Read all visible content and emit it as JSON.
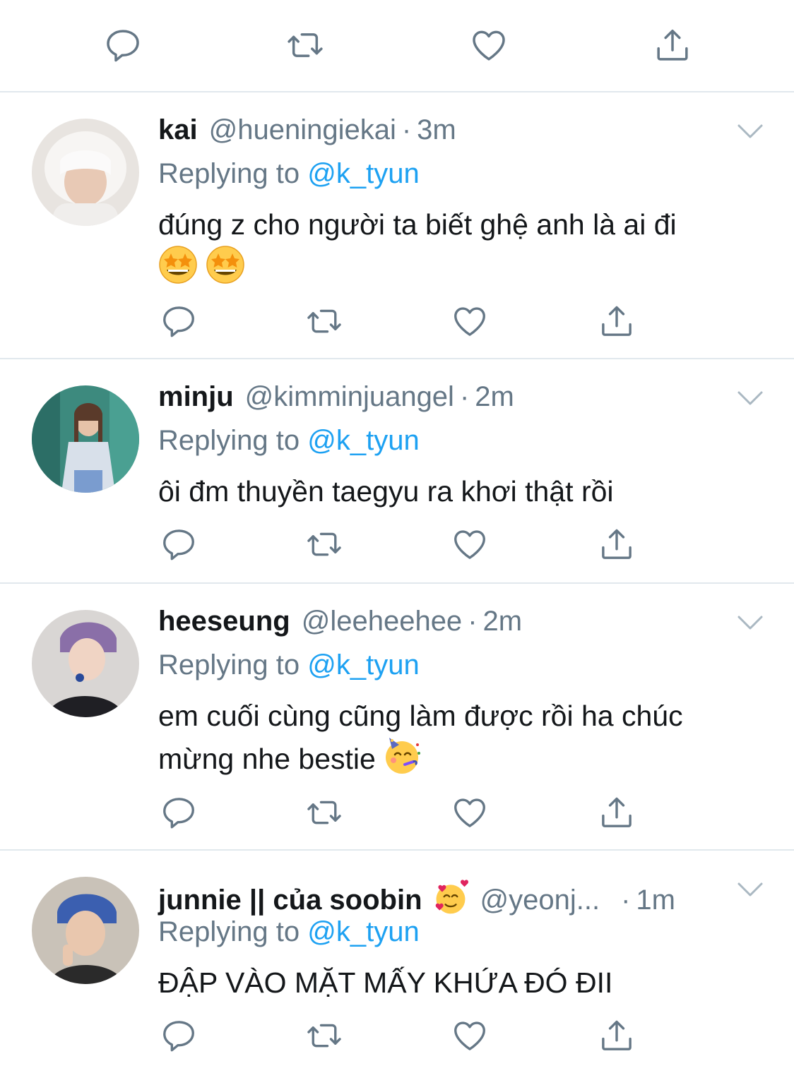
{
  "top_actions": {
    "reply_icon": "reply-icon",
    "retweet_icon": "retweet-icon",
    "like_icon": "like-icon",
    "share_icon": "share-icon"
  },
  "tweets": [
    {
      "name": "kai",
      "handle": "@hueningiekai",
      "dot": "·",
      "time": "3m",
      "replying_label": "Replying to",
      "mention": "@k_tyun",
      "text": "đúng z cho người ta biết ghệ anh là ai đi",
      "emojis": [
        "star-struck-emoji",
        "star-struck-emoji"
      ]
    },
    {
      "name": "minju",
      "handle": "@kimminjuangel",
      "dot": "·",
      "time": "2m",
      "replying_label": "Replying to",
      "mention": "@k_tyun",
      "text": "ôi đm thuyền taegyu ra khơi thật rồi"
    },
    {
      "name": "heeseung",
      "handle": "@leeheehee",
      "dot": "·",
      "time": "2m",
      "replying_label": "Replying to",
      "mention": "@k_tyun",
      "text_line1": "em cuối cùng cũng làm được rồi ha chúc",
      "text_line2": "mừng nhe bestie",
      "emojis": [
        "partying-face-emoji"
      ]
    },
    {
      "name": "junnie || của soobin",
      "name_emoji": "smiling-face-with-hearts-emoji",
      "handle": "@yeonj...",
      "dot": "·",
      "time": "1m",
      "replying_label": "Replying to",
      "mention": "@k_tyun",
      "text": "ĐẬP VÀO MẶT MẤY KHỨA ĐÓ ĐII"
    }
  ],
  "colors": {
    "icon_gray": "#657786",
    "mention_blue": "#1da1f2",
    "divider": "#e1e8ed",
    "text": "#14171a"
  }
}
